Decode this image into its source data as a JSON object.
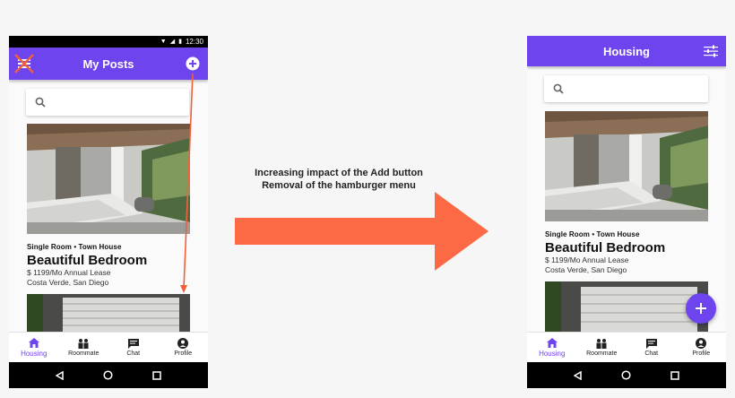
{
  "colors": {
    "primary": "#6e44ee",
    "arrow": "#fb6a45",
    "strike": "#f0613b"
  },
  "status_bar": {
    "time": "12:30"
  },
  "before": {
    "title": "My Posts",
    "left_icon": "hamburger-menu-icon-struck-out",
    "right_icon": "add-circle-icon"
  },
  "after": {
    "title": "Housing",
    "right_icon": "filter-sliders-icon",
    "fab_icon": "plus-icon"
  },
  "search": {
    "icon": "search-icon"
  },
  "listing": {
    "type": "Single Room • Town House",
    "title": "Beautiful Bedroom",
    "price_line": "$ 1199/Mo  Annual Lease",
    "location": "Costa Verde, San Diego"
  },
  "nav": [
    {
      "label": "Housing",
      "icon": "home-icon",
      "active": true
    },
    {
      "label": "Roommate",
      "icon": "roommate-icon",
      "active": false
    },
    {
      "label": "Chat",
      "icon": "chat-icon",
      "active": false
    },
    {
      "label": "Profile",
      "icon": "profile-icon",
      "active": false
    }
  ],
  "annotation": {
    "line1": "Increasing impact of the Add button",
    "line2": "Removal of the hamburger menu"
  }
}
